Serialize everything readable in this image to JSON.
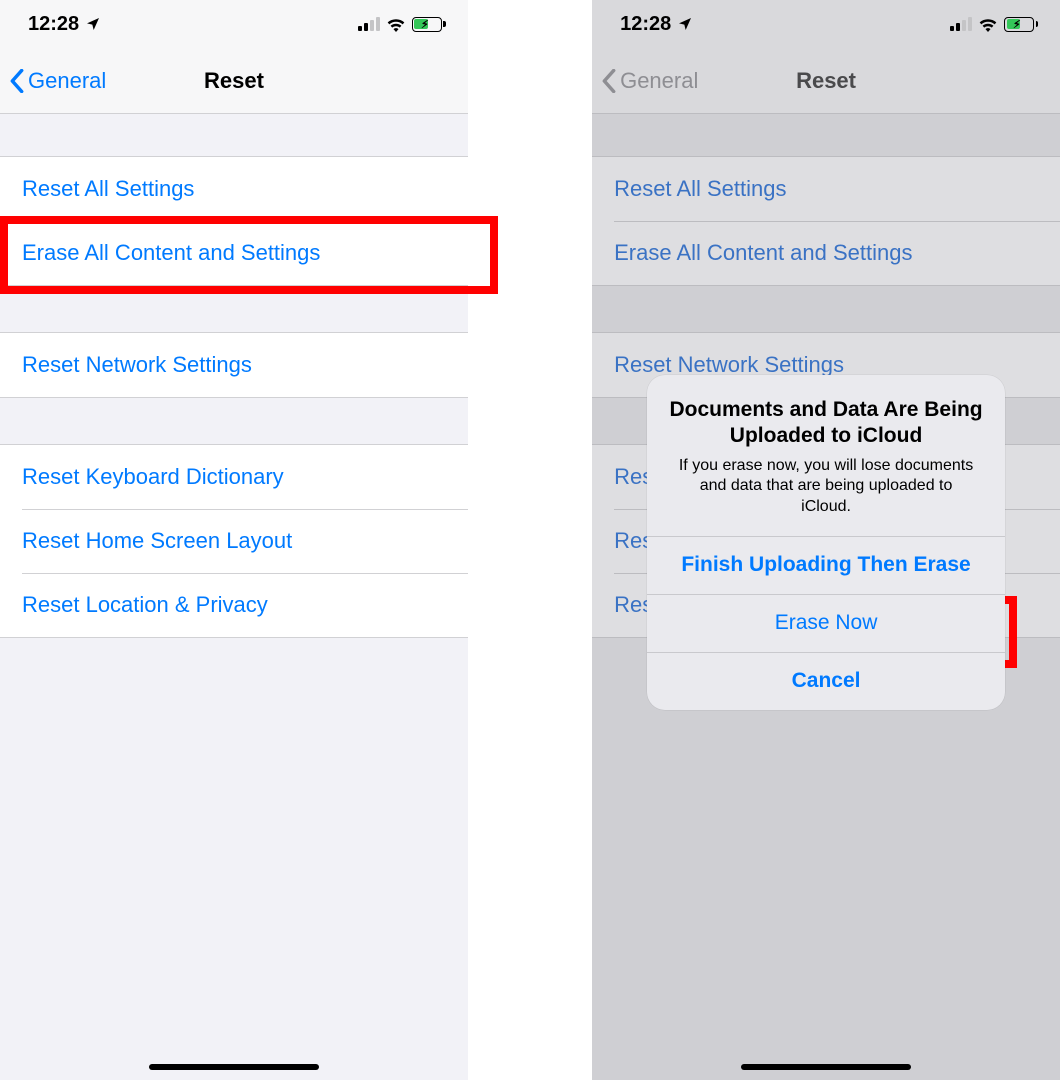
{
  "status": {
    "time": "12:28"
  },
  "nav": {
    "back_label": "General",
    "title": "Reset"
  },
  "rows": {
    "reset_all": "Reset All Settings",
    "erase_all": "Erase All Content and Settings",
    "reset_network": "Reset Network Settings",
    "reset_keyboard": "Reset Keyboard Dictionary",
    "reset_home": "Reset Home Screen Layout",
    "reset_location": "Reset Location & Privacy"
  },
  "rows_truncated": {
    "reset_keyboard": "Rese",
    "reset_home": "Rese",
    "reset_location": "Rese"
  },
  "alert": {
    "title": "Documents and Data Are Being Uploaded to iCloud",
    "message": "If you erase now, you will lose documents and data that are being uploaded to iCloud.",
    "btn_finish": "Finish Uploading Then Erase",
    "btn_erase": "Erase Now",
    "btn_cancel": "Cancel"
  }
}
